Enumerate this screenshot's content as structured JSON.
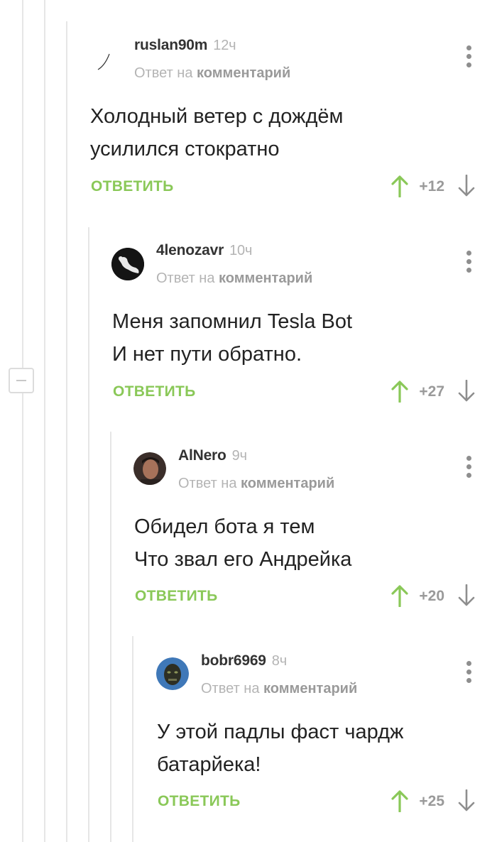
{
  "colors": {
    "accent_green": "#8ac858",
    "thread_line": "#e6e6e6",
    "muted": "#b4b4b4"
  },
  "thread": {
    "collapse_icon": "minus-icon"
  },
  "comments": [
    {
      "author": "ruslan90m",
      "time": "12ч",
      "reply_prefix": "Ответ на",
      "reply_target": "комментарий",
      "lines": [
        "Холодный ветер с дождём",
        "усилился стократно"
      ],
      "reply_label": "ОТВЕТИТЬ",
      "score": "+12"
    },
    {
      "author": "4lenozavr",
      "time": "10ч",
      "reply_prefix": "Ответ на",
      "reply_target": "комментарий",
      "lines": [
        "Меня запомнил Tesla Bot",
        "И нет пути обратно."
      ],
      "reply_label": "ОТВЕТИТЬ",
      "score": "+27"
    },
    {
      "author": "AlNero",
      "time": "9ч",
      "reply_prefix": "Ответ на",
      "reply_target": "комментарий",
      "lines": [
        "Обидел бота я тем",
        "Что звал его Андрейка"
      ],
      "reply_label": "ОТВЕТИТЬ",
      "score": "+20"
    },
    {
      "author": "bobr6969",
      "time": "8ч",
      "reply_prefix": "Ответ на",
      "reply_target": "комментарий",
      "lines": [
        "У этой падлы фаст чардж",
        "батарйека!"
      ],
      "reply_label": "ОТВЕТИТЬ",
      "score": "+25"
    }
  ]
}
